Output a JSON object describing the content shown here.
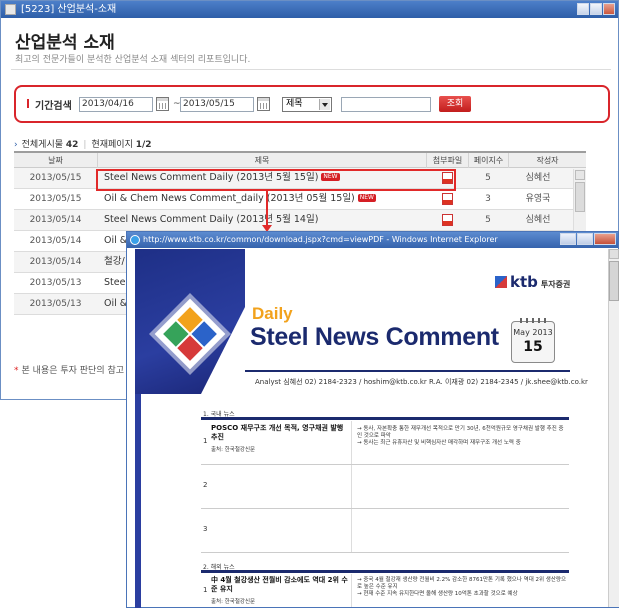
{
  "main_window": {
    "title": "[5223]  산업분석-소재"
  },
  "header": {
    "title": "산업분석 소재",
    "subtitle": "최고의 전문가들이 분석한 산업분석 소재 섹터의 리포트입니다."
  },
  "search": {
    "label": "기간검색",
    "date_from": "2013/04/16",
    "tilde": "~",
    "date_to": "2013/05/15",
    "field_selected": "제목",
    "keyword_value": "",
    "button_label": "조회"
  },
  "counts": {
    "total_label": "전체게시물",
    "total_value": "42",
    "page_label": "현재페이지",
    "page_value": "1/2"
  },
  "table": {
    "headers": [
      "날짜",
      "제목",
      "첨부파일",
      "페이지수",
      "작성자"
    ],
    "rows": [
      {
        "date": "2013/05/15",
        "title": "Steel News Comment Daily (2013년 5월 15일)",
        "new": "NEW",
        "pages": "5",
        "author": "심혜선"
      },
      {
        "date": "2013/05/15",
        "title": "Oil & Chem News Comment_daily (2013년 05월 15일)",
        "new": "NEW",
        "pages": "3",
        "author": "유영국"
      },
      {
        "date": "2013/05/14",
        "title": "Steel News Comment Daily (2013년 5월 14일)",
        "new": "",
        "pages": "5",
        "author": "심혜선"
      },
      {
        "date": "2013/05/14",
        "title": "Oil &",
        "new": "",
        "pages": "",
        "author": ""
      },
      {
        "date": "2013/05/14",
        "title": "철강/",
        "new": "",
        "pages": "",
        "author": ""
      },
      {
        "date": "2013/05/13",
        "title": "Steel",
        "new": "",
        "pages": "",
        "author": ""
      },
      {
        "date": "2013/05/13",
        "title": "Oil &",
        "new": "",
        "pages": "",
        "author": ""
      }
    ]
  },
  "notice": {
    "star": "*",
    "text": "본 내용은 투자 판단의 참고"
  },
  "ie_window": {
    "title": "http://www.ktb.co.kr/common/download.jspx?cmd=viewPDF - Windows Internet Explorer"
  },
  "pdf": {
    "logo": "ktb",
    "logo_sub": "투자증권",
    "daily": "Daily",
    "title": "Steel News Comment",
    "cal_month": "May 2013",
    "cal_day": "15",
    "analyst_line": "Analyst 심혜선  02) 2184-2323 / hoshim@ktb.co.kr     R.A. 이재광  02) 2184-2345 / jk.shee@ktb.co.kr",
    "section1": "1. 국내 뉴스",
    "item1_num": "1",
    "item1_title": "POSCO 재무구조 개선 목적, 영구채권 발행 추진",
    "item1_src": "출처: 한국철강신문",
    "item1_note": "→ 동사, 자본확충 통한 재무개선 목적으로 만기 30년, 6천억원규모 영구채권 발행 추진 중인 것으로 파악\n→ 동사는 최근 유휴자산 및 비핵심자산 매각하며 재무구조 개선 노력 중",
    "row2_num": "2",
    "row3_num": "3",
    "section2": "2. 해외 뉴스",
    "item4_num": "1",
    "item4_title": "中 4월 철강생산 전월비 감소에도 역대 2위 수준 유지",
    "item4_src": "출처: 한국철강신문",
    "item4_note": "→ 중국 4월 철강재 생산량 전월비 2.2% 감소한 8761만톤 기록 했으나 역대 2위 생산량으로 높은 수준 유지\n→ 현재 수준 지속 유지한다면 올해 생산량 10억톤 초과할 것으로 예상"
  },
  "colors": {
    "accent_red": "#d9252b",
    "titlebar_blue": "#2d5ea8",
    "report_navy": "#1b2a6e",
    "report_orange": "#f2a21c"
  }
}
